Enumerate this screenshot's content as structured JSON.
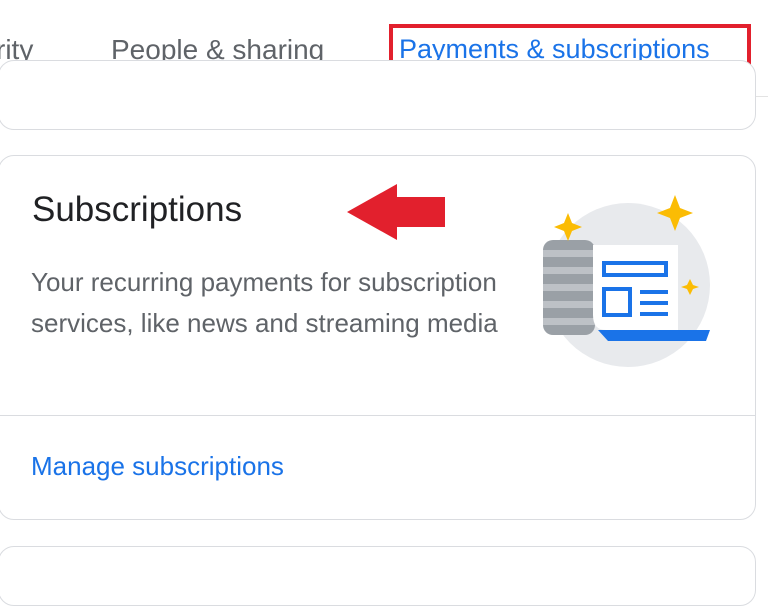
{
  "tabs": [
    {
      "label": "rity"
    },
    {
      "label": "People & sharing"
    },
    {
      "label": "Payments & subscriptions"
    }
  ],
  "card": {
    "title": "Subscriptions",
    "description": "Your recurring payments for subscription services, like news and streaming media",
    "link_label": "Manage subscriptions"
  },
  "colors": {
    "accent": "#1a73e8",
    "highlight": "#e2202d",
    "sparkle": "#fbbc04"
  },
  "icons": {
    "annotation_arrow": "arrow-left-icon",
    "illustration": "subscription-newspaper-icon"
  }
}
